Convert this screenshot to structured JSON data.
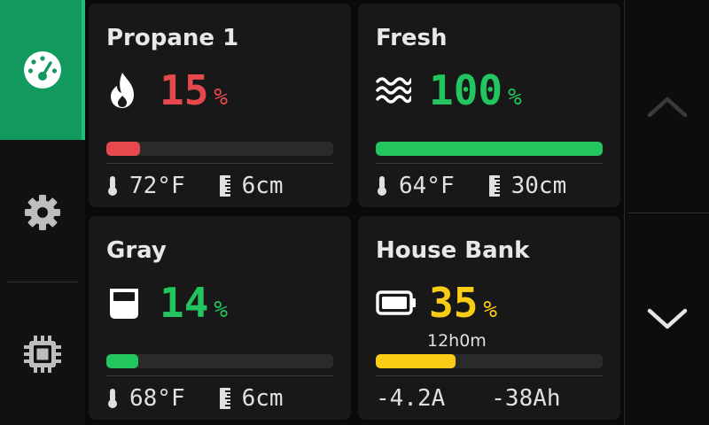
{
  "nav": {
    "items": [
      {
        "name": "dashboard",
        "icon": "gauge-icon",
        "active": true
      },
      {
        "name": "settings",
        "icon": "gear-icon",
        "active": false
      },
      {
        "name": "system",
        "icon": "chip-icon",
        "active": false
      }
    ],
    "active_color": "#129a5e"
  },
  "cards": {
    "propane": {
      "title": "Propane 1",
      "icon": "flame-icon",
      "percent": "15",
      "percent_unit": "%",
      "level": 0.15,
      "color": "#e5484d",
      "temp": "72°F",
      "depth": "6cm"
    },
    "fresh": {
      "title": "Fresh",
      "icon": "water-waves-icon",
      "percent": "100",
      "percent_unit": "%",
      "level": 1.0,
      "color": "#22c55e",
      "temp": "64°F",
      "depth": "30cm"
    },
    "gray": {
      "title": "Gray",
      "icon": "gray-tank-icon",
      "percent": "14",
      "percent_unit": "%",
      "level": 0.14,
      "color": "#22c55e",
      "temp": "68°F",
      "depth": "6cm"
    },
    "house_bank": {
      "title": "House Bank",
      "icon": "battery-icon",
      "percent": "35",
      "percent_unit": "%",
      "level": 0.35,
      "color": "#facc15",
      "runtime": "12h0m",
      "current": "-4.2A",
      "amp_hours": "-38Ah"
    }
  },
  "scroll": {
    "up_icon": "chevron-up-icon",
    "down_icon": "chevron-down-icon"
  }
}
